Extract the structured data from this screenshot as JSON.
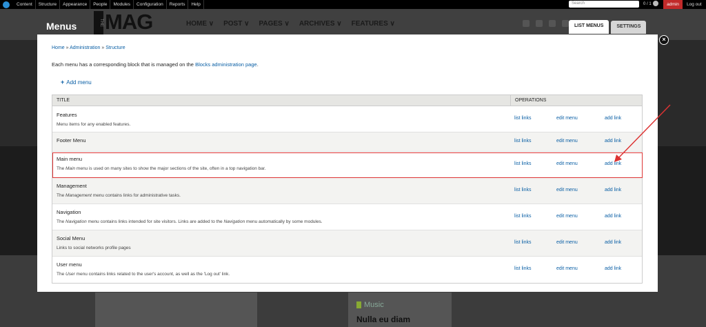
{
  "toolbar": {
    "items": [
      "Content",
      "Structure",
      "Appearance",
      "People",
      "Modules",
      "Configuration",
      "Reports",
      "Help"
    ],
    "search_placeholder": "Search",
    "count": "0 / 1",
    "user": "admin",
    "logout": "Log out"
  },
  "site": {
    "page_title": "Menus",
    "brand_the": "THE",
    "brand": "MAG",
    "nav": [
      "HOME ∨",
      "POST ∨",
      "PAGES ∨",
      "ARCHIVES ∨",
      "FEATURES ∨"
    ],
    "tabs": [
      "LIST MENUS",
      "SETTINGS"
    ],
    "music": "Music",
    "nulla": "Nulla eu diam"
  },
  "modal": {
    "breadcrumb": [
      "Home",
      "Administration",
      "Structure"
    ],
    "intro_before": "Each menu has a corresponding block that is managed on the ",
    "intro_link": "Blocks administration page",
    "intro_after": ".",
    "add_menu": "Add menu",
    "columns": {
      "title": "TITLE",
      "operations": "OPERATIONS"
    },
    "op_labels": {
      "list": "list links",
      "edit": "edit menu",
      "add": "add link"
    },
    "menus": [
      {
        "name": "Features",
        "desc_pre": "Menu items for any enabled features.",
        "desc_em": "",
        "desc_post": ""
      },
      {
        "name": "Footer Menu",
        "desc_pre": "",
        "desc_em": "",
        "desc_post": ""
      },
      {
        "name": "Main menu",
        "desc_pre": "The ",
        "desc_em": "Main",
        "desc_post": " menu is used on many sites to show the major sections of the site, often in a top navigation bar."
      },
      {
        "name": "Management",
        "desc_pre": "The ",
        "desc_em": "Management",
        "desc_post": " menu contains links for administrative tasks."
      },
      {
        "name": "Navigation",
        "desc_pre": "The ",
        "desc_em": "Navigation",
        "desc_post": " menu contains links intended for site visitors. Links are added to the ",
        "desc_em2": "Navigation",
        "desc_post2": " menu automatically by some modules."
      },
      {
        "name": "Social Menu",
        "desc_pre": "Links to social networks profile pages",
        "desc_em": "",
        "desc_post": ""
      },
      {
        "name": "User menu",
        "desc_pre": "The ",
        "desc_em": "User",
        "desc_post": " menu contains links related to the user's account, as well as the 'Log out' link."
      }
    ]
  },
  "colors": {
    "link": "#0a5fa5",
    "highlight": "#dd3333",
    "admin": "#c12a2a"
  }
}
